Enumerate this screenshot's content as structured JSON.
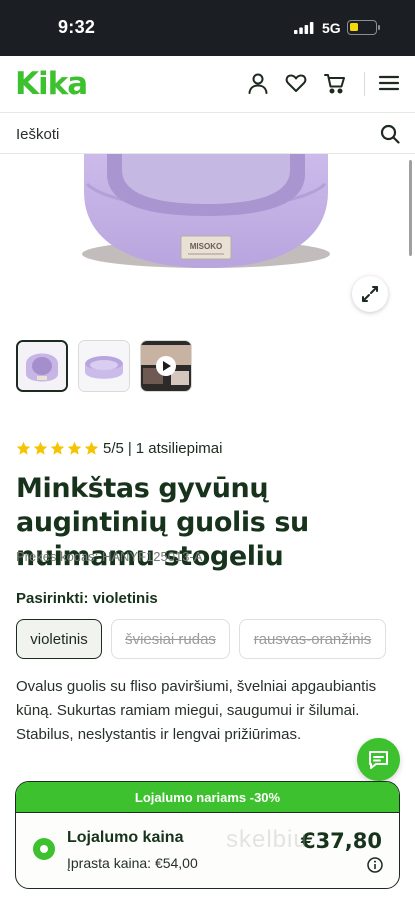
{
  "status_bar": {
    "time": "9:32",
    "network": "5G"
  },
  "header": {
    "logo": "Kika",
    "icons": [
      "user-icon",
      "heart-icon",
      "cart-icon",
      "menu-icon"
    ]
  },
  "search": {
    "placeholder": "Ieškoti"
  },
  "gallery": {
    "thumbnails": [
      "product-front",
      "product-side",
      "product-video"
    ]
  },
  "rating": {
    "stars": 5,
    "score": "5/5",
    "separator": "|",
    "count_text": "1 atsiliepimai"
  },
  "product": {
    "title": "Minkštas gyvūnų augintinių guolis su nuimamu stogeliu",
    "sku": "Prekės kodas: HANYF125013-A",
    "option_label": "Pasirinkti: violetinis",
    "options": [
      {
        "label": "violetinis",
        "state": "selected"
      },
      {
        "label": "šviesiai rudas",
        "state": "unavailable"
      },
      {
        "label": "rausvas-oranžinis",
        "state": "unavailable"
      }
    ],
    "description": "Ovalus guolis su fliso paviršiumi, švelniai apgaubiantis kūną. Sukurtas ramiam miegui, saugumui ir šilumai. Stabilus, neslystantis ir lengvai prižiūrimas."
  },
  "loyalty": {
    "banner": "Lojalumo nariams -30%",
    "label": "Lojalumo kaina",
    "regular_price": "Įprasta kaina: €54,00",
    "price": "€37,80"
  },
  "colors": {
    "brand_green": "#3ec12e",
    "dark_green": "#17331c",
    "star_yellow": "#f5c400",
    "product_lilac": "#c9b6e6"
  },
  "watermark": "skelbiu"
}
